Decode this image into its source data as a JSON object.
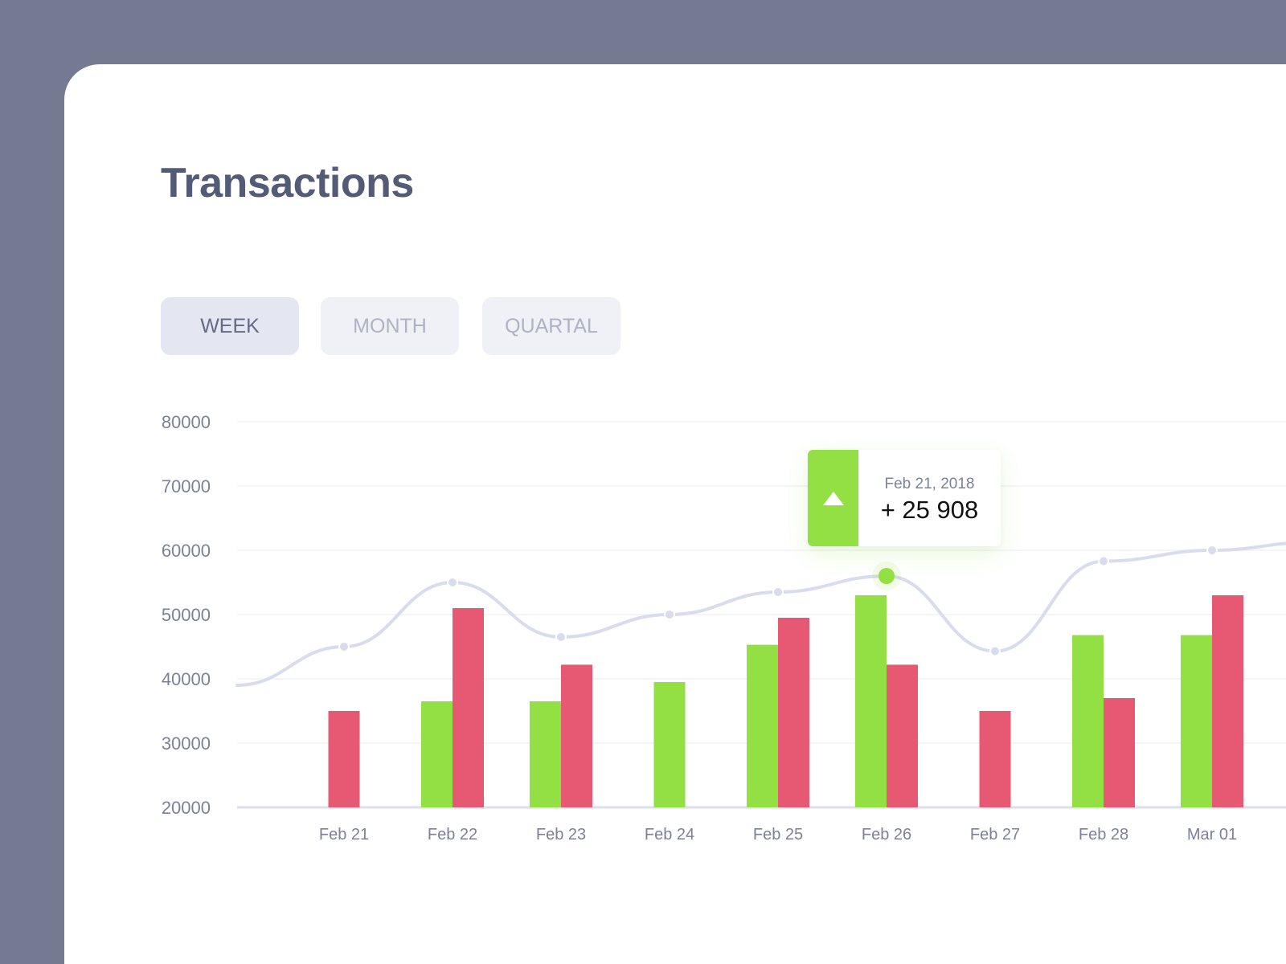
{
  "page": {
    "title": "Transactions"
  },
  "tabs": [
    {
      "label": "WEEK",
      "active": true
    },
    {
      "label": "MONTH",
      "active": false
    },
    {
      "label": "QUARTAL",
      "active": false
    }
  ],
  "tooltip": {
    "date": "Feb 21, 2018",
    "value": "+ 25 908",
    "direction": "up"
  },
  "colors": {
    "background": "#757a93",
    "card": "#ffffff",
    "title": "#545b76",
    "income": "#93e044",
    "expense": "#e75872",
    "line": "#d8dcec",
    "highlight_point": "#93e044"
  },
  "chart_data": {
    "type": "bar",
    "categories": [
      "Feb 21",
      "Feb 22",
      "Feb 23",
      "Feb 24",
      "Feb 25",
      "Feb 26",
      "Feb 27",
      "Feb 28",
      "Mar 01"
    ],
    "series": [
      {
        "values": [
          null,
          36500,
          36500,
          39500,
          45300,
          53000,
          null,
          46800,
          46800
        ]
      },
      {
        "values": [
          35000,
          51000,
          42200,
          null,
          49500,
          42200,
          35000,
          37000,
          53000
        ]
      }
    ],
    "line_series": {
      "type": "line",
      "smooth": true,
      "points": [
        {
          "x": "Feb 21",
          "y": 45000
        },
        {
          "x": "Feb 22",
          "y": 55000
        },
        {
          "x": "Feb 23",
          "y": 46500
        },
        {
          "x": "Feb 24",
          "y": 50000
        },
        {
          "x": "Feb 25",
          "y": 53500
        },
        {
          "x": "Feb 26",
          "y": 56000
        },
        {
          "x": "Feb 27",
          "y": 44300
        },
        {
          "x": "Feb 28",
          "y": 58300
        },
        {
          "x": "Mar 01",
          "y": 60000
        }
      ],
      "highlighted": "Feb 26"
    },
    "yticks": [
      80000,
      70000,
      60000,
      50000,
      40000,
      30000,
      20000
    ],
    "ylim": [
      20000,
      80000
    ],
    "title": "",
    "xlabel": "",
    "ylabel": "",
    "grid": true,
    "legend": "none"
  }
}
